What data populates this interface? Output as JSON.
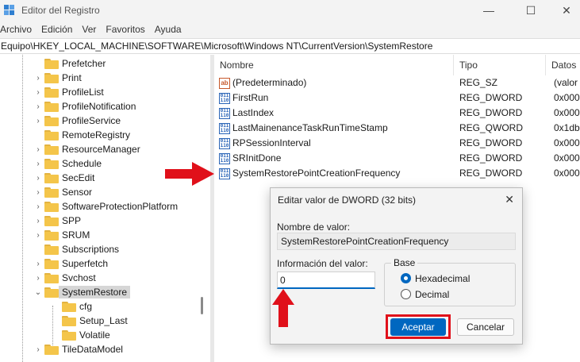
{
  "window": {
    "title": "Editor del Registro",
    "controls": {
      "minimize": "—",
      "maximize": "☐",
      "close": "✕"
    }
  },
  "menu": [
    "Archivo",
    "Edición",
    "Ver",
    "Favoritos",
    "Ayuda"
  ],
  "address": "Equipo\\HKEY_LOCAL_MACHINE\\SOFTWARE\\Microsoft\\Windows NT\\CurrentVersion\\SystemRestore",
  "tree": {
    "items": [
      {
        "label": "Prefetcher",
        "expander": ""
      },
      {
        "label": "Print",
        "expander": "›"
      },
      {
        "label": "ProfileList",
        "expander": "›"
      },
      {
        "label": "ProfileNotification",
        "expander": "›"
      },
      {
        "label": "ProfileService",
        "expander": "›"
      },
      {
        "label": "RemoteRegistry",
        "expander": ""
      },
      {
        "label": "ResourceManager",
        "expander": "›"
      },
      {
        "label": "Schedule",
        "expander": "›"
      },
      {
        "label": "SecEdit",
        "expander": "›"
      },
      {
        "label": "Sensor",
        "expander": "›"
      },
      {
        "label": "SoftwareProtectionPlatform",
        "expander": "›"
      },
      {
        "label": "SPP",
        "expander": "›"
      },
      {
        "label": "SRUM",
        "expander": "›"
      },
      {
        "label": "Subscriptions",
        "expander": ""
      },
      {
        "label": "Superfetch",
        "expander": "›"
      },
      {
        "label": "Svchost",
        "expander": "›"
      },
      {
        "label": "SystemRestore",
        "expander": "⌄",
        "selected": true
      },
      {
        "label": "cfg",
        "expander": "",
        "child": true
      },
      {
        "label": "Setup_Last",
        "expander": "",
        "child": true
      },
      {
        "label": "Volatile",
        "expander": "",
        "child": true
      },
      {
        "label": "TileDataModel",
        "expander": "›"
      }
    ]
  },
  "list": {
    "columns": [
      "Nombre",
      "Tipo",
      "Datos"
    ],
    "rows": [
      {
        "icon": "string-value-icon",
        "name": "(Predeterminado)",
        "type": "REG_SZ",
        "data": "(valor"
      },
      {
        "icon": "binary-value-icon",
        "name": "FirstRun",
        "type": "REG_DWORD",
        "data": "0x0000"
      },
      {
        "icon": "binary-value-icon",
        "name": "LastIndex",
        "type": "REG_DWORD",
        "data": "0x0000"
      },
      {
        "icon": "binary-value-icon",
        "name": "LastMainenanceTaskRunTimeStamp",
        "type": "REG_QWORD",
        "data": "0x1db8"
      },
      {
        "icon": "binary-value-icon",
        "name": "RPSessionInterval",
        "type": "REG_DWORD",
        "data": "0x0000"
      },
      {
        "icon": "binary-value-icon",
        "name": "SRInitDone",
        "type": "REG_DWORD",
        "data": "0x0000"
      },
      {
        "icon": "binary-value-icon",
        "name": "SystemRestorePointCreationFrequency",
        "type": "REG_DWORD",
        "data": "0x0000"
      }
    ]
  },
  "dialog": {
    "title": "Editar valor de DWORD (32 bits)",
    "close": "✕",
    "name_label": "Nombre de valor:",
    "name_value": "SystemRestorePointCreationFrequency",
    "data_label": "Información del valor:",
    "data_value": "0",
    "base_label": "Base",
    "radio_hex": "Hexadecimal",
    "radio_dec": "Decimal",
    "selected_base": "Hexadecimal",
    "ok": "Aceptar",
    "cancel": "Cancelar"
  },
  "colors": {
    "accent": "#0067c0",
    "annotation": "#e0101a",
    "folder": "#f4c54a"
  }
}
